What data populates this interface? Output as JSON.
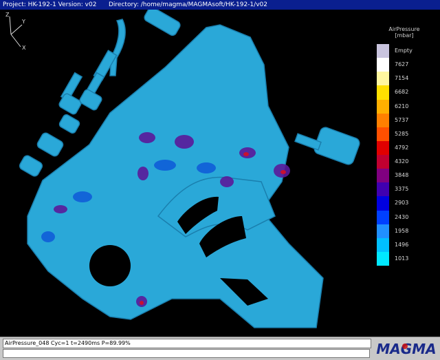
{
  "titlebar": {
    "project": "Project: HK-192-1 Version: v02",
    "directory": "Directory: /home/magma/MAGMAsoft/HK-192-1/v02"
  },
  "legend": {
    "title_line1": "AirPressure",
    "title_line2": "[mbar]",
    "entries": [
      {
        "label": "Empty",
        "color": "#c9c4de"
      },
      {
        "label": "7627",
        "color": "#ffffff"
      },
      {
        "label": "7154",
        "color": "#fff7a0"
      },
      {
        "label": "6682",
        "color": "#ffe000"
      },
      {
        "label": "6210",
        "color": "#ffb000"
      },
      {
        "label": "5737",
        "color": "#ff8000"
      },
      {
        "label": "5285",
        "color": "#ff5000"
      },
      {
        "label": "4792",
        "color": "#e00000"
      },
      {
        "label": "4320",
        "color": "#c00030"
      },
      {
        "label": "3848",
        "color": "#800080"
      },
      {
        "label": "3375",
        "color": "#4000b0"
      },
      {
        "label": "2903",
        "color": "#0000e0"
      },
      {
        "label": "2430",
        "color": "#0040ff"
      },
      {
        "label": "1958",
        "color": "#2090ff"
      },
      {
        "label": "1496",
        "color": "#00c0ff"
      },
      {
        "label": "1013",
        "color": "#00e8ff"
      }
    ]
  },
  "axes": {
    "z": "Z",
    "y": "Y",
    "x": "X"
  },
  "status": {
    "message": "AirPressure_048 Cyc=1 t=2490ms P=89.99%"
  },
  "logo": {
    "text": "MAGMA",
    "colors": {
      "primary": "#1a2a8a",
      "accent": "#cc1111"
    }
  },
  "colors": {
    "casting": "#2aa8d8",
    "casting_dark": "#1a7fae",
    "high_pressure": "#5a1a9a"
  }
}
